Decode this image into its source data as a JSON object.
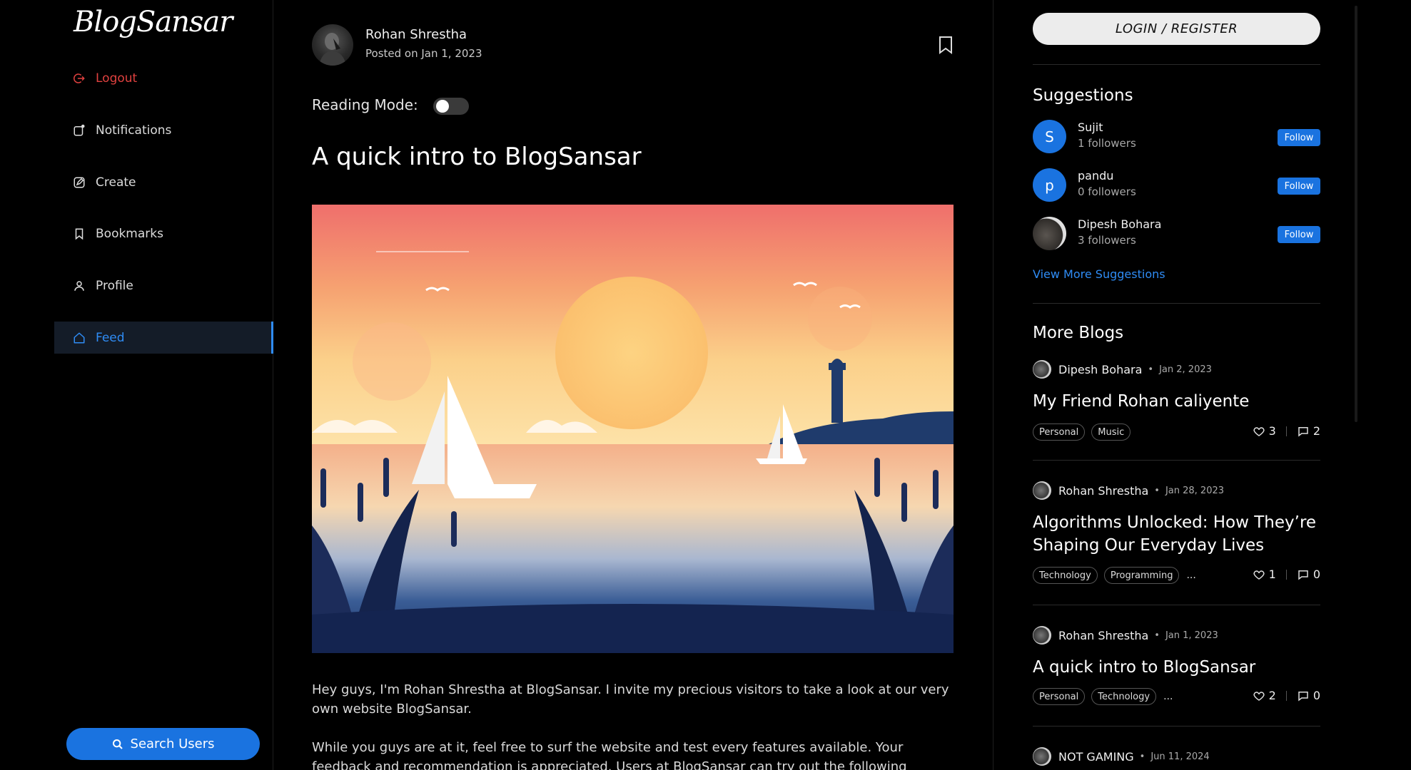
{
  "app": {
    "logo": "BlogSansar"
  },
  "sidebar": {
    "items": [
      {
        "label": "Logout",
        "icon": "logout-icon"
      },
      {
        "label": "Notifications",
        "icon": "bell-icon"
      },
      {
        "label": "Create",
        "icon": "edit-icon"
      },
      {
        "label": "Bookmarks",
        "icon": "bookmark-icon"
      },
      {
        "label": "Profile",
        "icon": "user-icon"
      },
      {
        "label": "Feed",
        "icon": "home-icon",
        "active": true
      }
    ],
    "search_button": "Search Users"
  },
  "post": {
    "author": "Rohan Shrestha",
    "date": "Posted on Jan 1, 2023",
    "reading_mode_label": "Reading Mode:",
    "reading_mode_on": false,
    "title": "A quick intro to BlogSansar",
    "paragraphs": [
      "Hey guys, I'm Rohan Shrestha at BlogSansar. I invite my precious visitors to take a look at our very own website BlogSansar.",
      "While you guys are at it, feel free to surf the website and test every features available. Your feedback and recommendation is appreciated. Users at BlogSansar can try out the following"
    ]
  },
  "right": {
    "login_button": "LOGIN / REGISTER",
    "suggestions_heading": "Suggestions",
    "suggestions": [
      {
        "initial": "S",
        "name": "Sujit",
        "followers": "1 followers",
        "follow": "Follow"
      },
      {
        "initial": "p",
        "name": "pandu",
        "followers": "0 followers",
        "follow": "Follow"
      },
      {
        "initial": "",
        "name": "Dipesh Bohara",
        "followers": "3 followers",
        "follow": "Follow"
      }
    ],
    "view_more": "View More Suggestions",
    "more_blogs_heading": "More Blogs",
    "blogs": [
      {
        "author": "Dipesh Bohara",
        "date": "Jan 2, 2023",
        "title": "My Friend Rohan caliyente",
        "tags": [
          "Personal",
          "Music"
        ],
        "more": "",
        "likes": "3",
        "comments": "2"
      },
      {
        "author": "Rohan Shrestha",
        "date": "Jan 28, 2023",
        "title": "Algorithms Unlocked: How They’re Shaping Our Everyday Lives",
        "tags": [
          "Technology",
          "Programming"
        ],
        "more": "...",
        "likes": "1",
        "comments": "0"
      },
      {
        "author": "Rohan Shrestha",
        "date": "Jan 1, 2023",
        "title": "A quick intro to BlogSansar",
        "tags": [
          "Personal",
          "Technology"
        ],
        "more": "...",
        "likes": "2",
        "comments": "0"
      },
      {
        "author": "NOT GAMING",
        "date": "Jun 11, 2024",
        "title": "",
        "tags": [],
        "more": "",
        "likes": "",
        "comments": ""
      }
    ],
    "dot": "•"
  },
  "colors": {
    "accent": "#1a73e0",
    "link": "#2f8cf5",
    "danger": "#e0413f",
    "background": "#000000"
  }
}
